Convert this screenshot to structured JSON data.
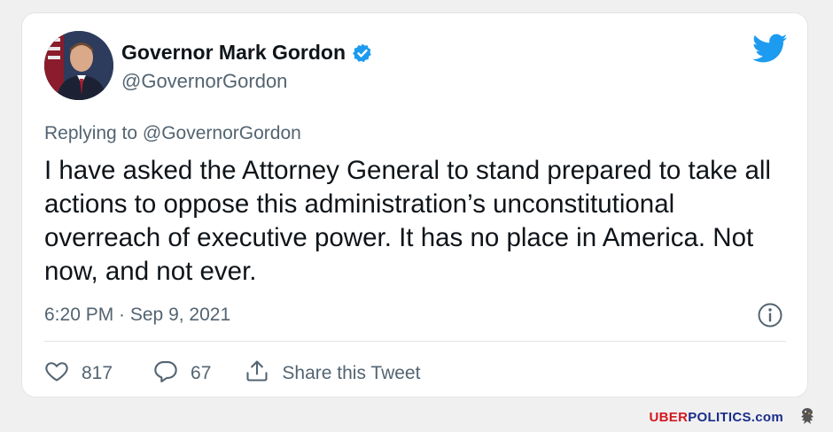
{
  "tweet": {
    "author_name": "Governor Mark Gordon",
    "author_handle": "@GovernorGordon",
    "verified_icon": "verified-badge-icon",
    "replying_to": "Replying to @GovernorGordon",
    "text": "I have asked the Attorney General to stand prepared to take all actions to oppose this administration’s unconstitutional overreach of executive power. It has no place in America. Not now, and not ever.",
    "timestamp": "6:20 PM · Sep 9, 2021",
    "likes": "817",
    "replies": "67",
    "share_label": "Share this Tweet"
  },
  "watermark": {
    "part1": "UBER",
    "part2": "POLITICS",
    "part3": ".com"
  },
  "colors": {
    "twitter_blue": "#1d9bf0",
    "text_primary": "#0f1419",
    "text_secondary": "#536471",
    "watermark_red": "#d4181f",
    "watermark_blue": "#1a2d8a"
  },
  "icons": [
    "twitter-bird-icon",
    "info-icon",
    "heart-icon",
    "reply-icon",
    "share-icon",
    "eagle-logo"
  ]
}
